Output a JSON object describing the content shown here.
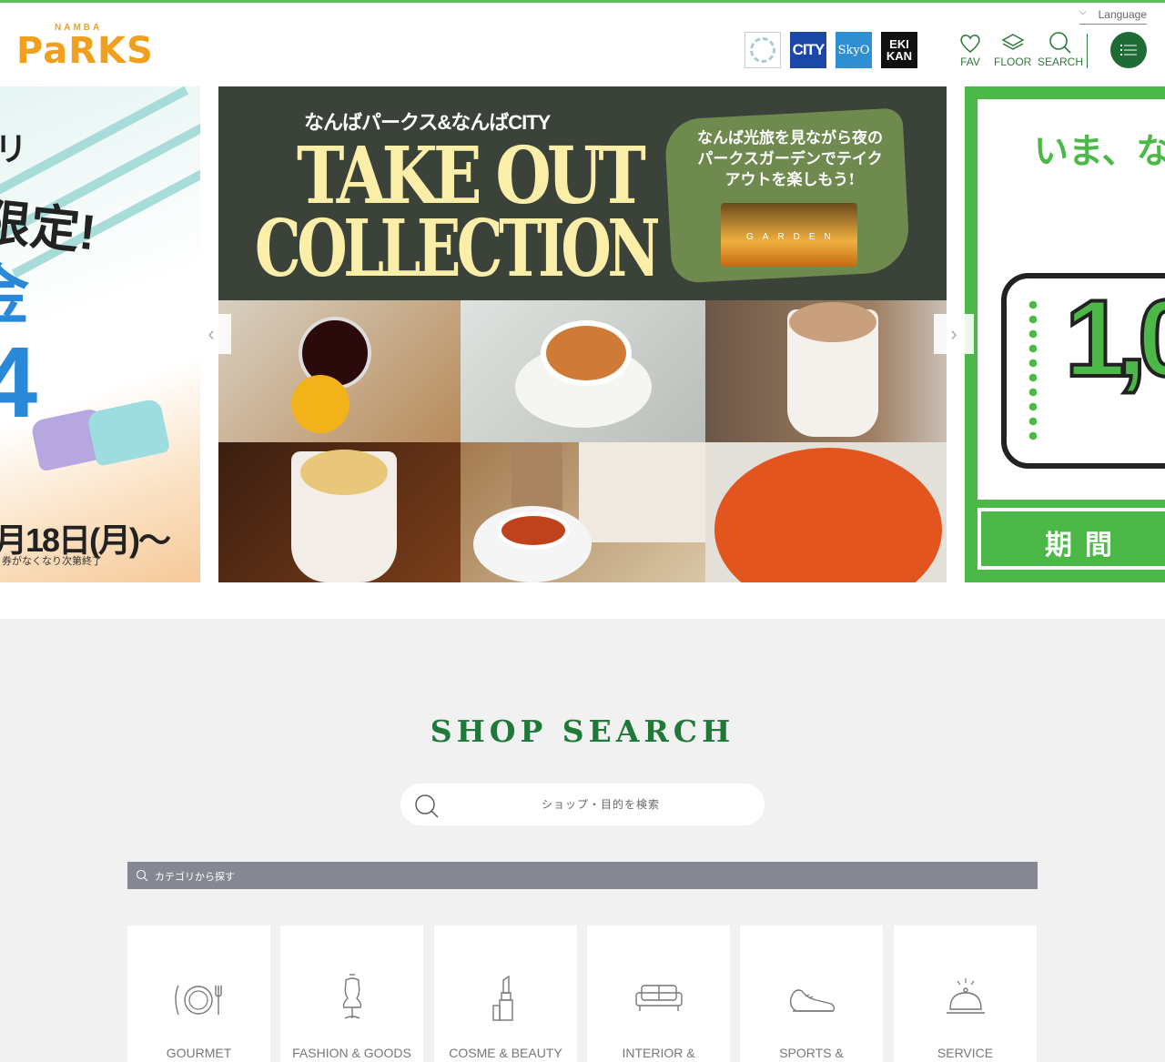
{
  "header": {
    "logo_small": "NAMBA",
    "logo_big": "PaRKS",
    "sisters": [
      {
        "label": ""
      },
      {
        "label": "CITY"
      },
      {
        "label": "SkyO"
      },
      {
        "label": "EKI KAN"
      }
    ],
    "nav": {
      "fav": "FAV",
      "floor": "FLOOR",
      "search": "SEARCH"
    },
    "language": "Language",
    "accent_color": "#1e6b35"
  },
  "carousel": {
    "left": {
      "t1": "リ",
      "t2": "限定!",
      "t3": "金",
      "t4": "4",
      "date": "月18日(月)〜",
      "note": "券がなくなり次第終了"
    },
    "main": {
      "subtitle": "なんばパークス&なんばCITY",
      "title_line1": "TAKE OUT",
      "title_line2": "COLLECTION",
      "badge_text": "なんば光旅を見ながら夜のパークスガーデンでテイクアウトを楽しもう!",
      "badge_photo_text": "GARDEN"
    },
    "right": {
      "headline": "いま、な",
      "amount": "1,0",
      "period": "期間"
    },
    "prev_arrow": "‹",
    "next_arrow": "›"
  },
  "shop_search": {
    "title": "SHOP SEARCH",
    "search_placeholder": "ショップ・目的を検索",
    "category_bar": "カテゴリから探す",
    "categories": [
      {
        "label": "GOURMET",
        "icon": "plate-cutlery-icon"
      },
      {
        "label": "FASHION & GOODS",
        "icon": "mannequin-icon"
      },
      {
        "label": "COSME & BEAUTY",
        "icon": "lipstick-icon"
      },
      {
        "label": "INTERIOR &",
        "icon": "sofa-icon"
      },
      {
        "label": "SPORTS &",
        "icon": "sneaker-icon"
      },
      {
        "label": "SERVICE",
        "icon": "service-bell-icon"
      }
    ]
  }
}
